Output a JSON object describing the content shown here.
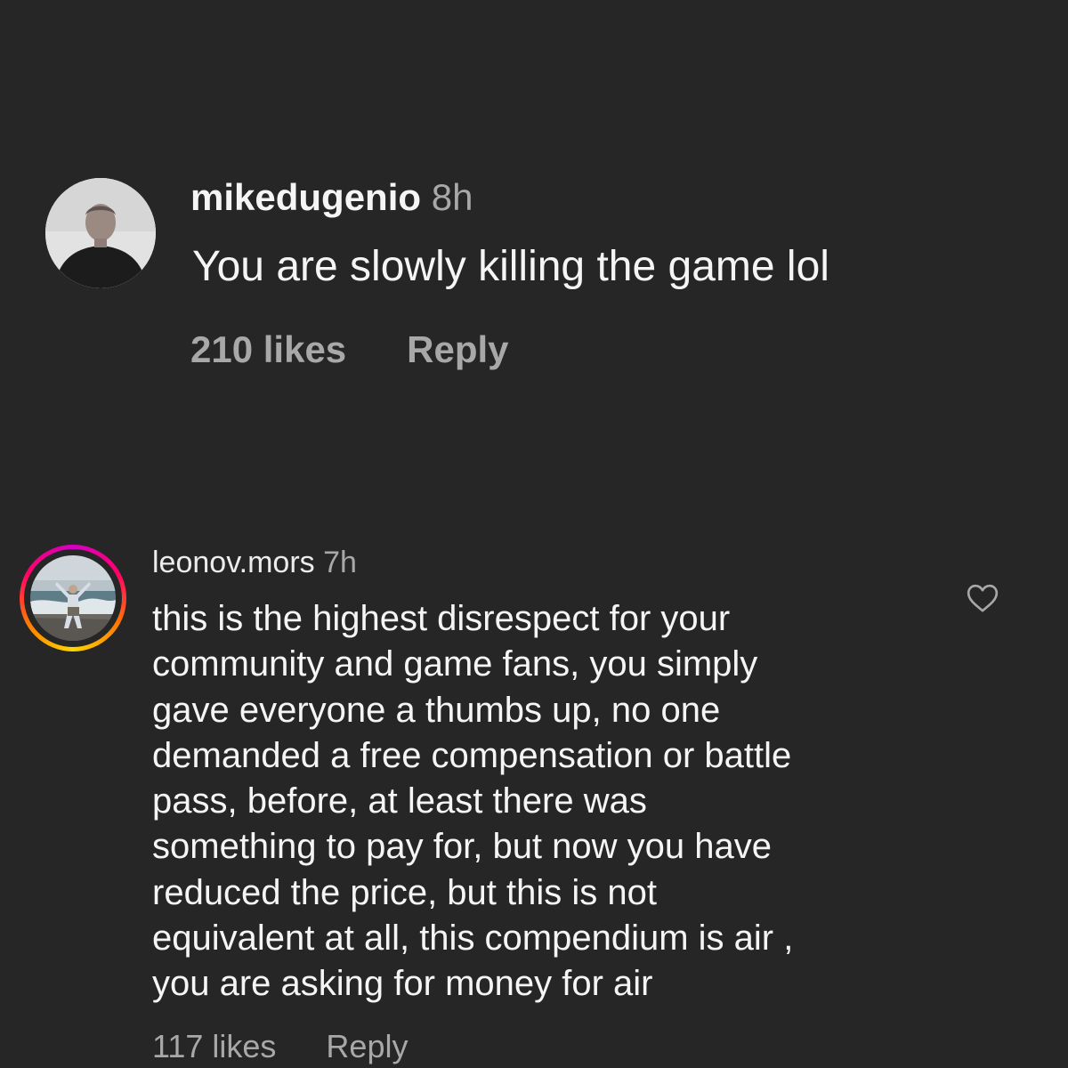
{
  "comments": [
    {
      "username": "mikedugenio",
      "time": "8h",
      "text": "You are slowly killing the game lol",
      "likes": "210 likes",
      "reply_label": "Reply",
      "avatar_icon": "profile-photo-man-icon"
    },
    {
      "username": "leonov.mors",
      "time": "7h",
      "text_lines": [
        "this is the highest disrespect for your",
        "community and game fans, you simply",
        "gave everyone a thumbs up, no one",
        "demanded a free compensation or battle",
        "pass, before, at least there was",
        "something to pay for, but now you have",
        "reduced the price, but this is not",
        "equivalent at all, this compendium is air ,",
        "you are asking for money for air"
      ],
      "likes": "117 likes",
      "reply_label": "Reply",
      "avatar_icon": "profile-photo-beach-icon",
      "has_story_ring": true,
      "like_icon": "heart-icon"
    }
  ],
  "colors": {
    "background": "#262626",
    "primary_text": "#f5f5f5",
    "secondary_text": "#a8a8a8"
  }
}
